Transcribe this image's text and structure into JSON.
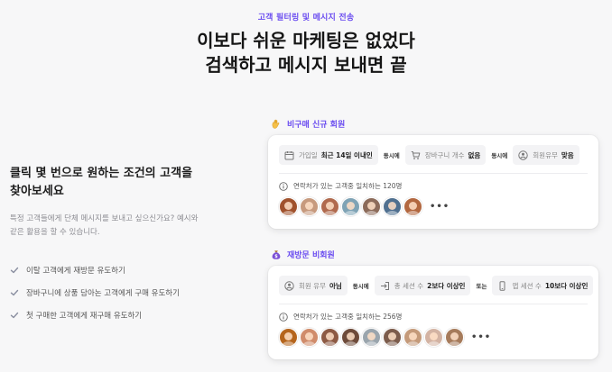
{
  "hero": {
    "eyebrow": "고객 필터링 및 메시지 전송",
    "headline_line1": "이보다 쉬운 마케팅은 없었다",
    "headline_line2": "검색하고 메시지 보내면 끝"
  },
  "left": {
    "title_line1": "클릭 몇 번으로 원하는 조건의 고객을",
    "title_line2": "찾아보세요",
    "desc_line1": "특정 고객들에게 단체 메시지를 보내고 싶으신가요? 예시와",
    "desc_line2": "같은 활용을 할 수 있습니다.",
    "checklist": [
      "이탈 고객에게 재방문 유도하기",
      "장바구니에 상품 담아논 고객에게 구매 유도하기",
      "첫 구매한 고객에게 재구매 유도하기"
    ]
  },
  "segments": [
    {
      "label": "비구매 신규 회원",
      "icon": "waving-hand-icon",
      "filters": [
        {
          "label": "가입일",
          "value": "최근 14일 이내인",
          "icon": "calendar-icon"
        },
        {
          "label": "장바구니 개수",
          "value": "없음",
          "icon": "cart-icon"
        },
        {
          "label": "회원유무",
          "value": "맞음",
          "icon": "user-icon"
        }
      ],
      "connectors": [
        "동시에",
        "동시에"
      ],
      "match_text": "연락처가 있는 고객중 일치하는 120명",
      "avatar_colors": [
        "#a0522d",
        "#c79a7e",
        "#b06a4e",
        "#7fa3b5",
        "#8c6b5a",
        "#4f6f8f",
        "#b2673f"
      ],
      "more": "•••"
    },
    {
      "label": "재방문 비회원",
      "icon": "moneybag-icon",
      "filters": [
        {
          "label": "회원 유무",
          "value": "아님",
          "icon": "user-icon"
        },
        {
          "label": "총 세션 수",
          "value": "2보다 이상인",
          "icon": "login-icon"
        },
        {
          "label": "앱 세션 수",
          "value": "10보다 이상인",
          "icon": "phone-icon"
        }
      ],
      "connectors": [
        "동시에",
        "또는"
      ],
      "match_text": "연락처가 있는 고객중 일치하는 256명",
      "avatar_colors": [
        "#b5651d",
        "#d08c6b",
        "#8d5a44",
        "#6e4b3a",
        "#9aa5ad",
        "#7c5c4c",
        "#c49a7a",
        "#d3b3a3",
        "#a67b5b"
      ],
      "more": "•••"
    }
  ],
  "colors": {
    "accent": "#6a4cf0",
    "background": "#f7f7f8",
    "card": "#ffffff"
  }
}
